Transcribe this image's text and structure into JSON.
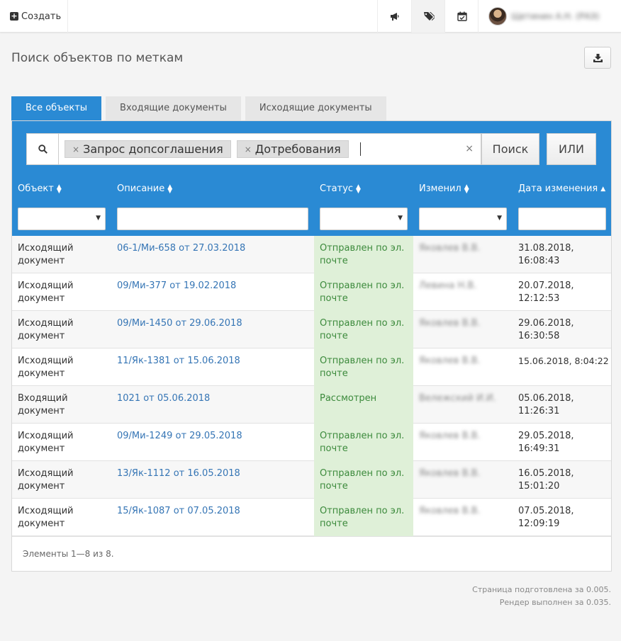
{
  "topbar": {
    "create_label": "Создать",
    "icons": [
      "megaphone-icon",
      "tags-icon",
      "calendar-check-icon"
    ],
    "user_name": "Щетинин А.Н. (РАЭ)"
  },
  "page": {
    "title": "Поиск объектов по меткам"
  },
  "tabs": [
    {
      "label": "Все объекты",
      "active": true
    },
    {
      "label": "Входящие документы",
      "active": false
    },
    {
      "label": "Исходящие документы",
      "active": false
    }
  ],
  "search": {
    "tags": [
      "Запрос допсоглашения",
      "Дотребования"
    ],
    "search_label": "Поиск",
    "or_label": "ИЛИ"
  },
  "columns": [
    {
      "label": "Объект",
      "sort": "both"
    },
    {
      "label": "Описание",
      "sort": "both"
    },
    {
      "label": "Статус",
      "sort": "both"
    },
    {
      "label": "Изменил",
      "sort": "both"
    },
    {
      "label": "Дата изменения",
      "sort": "asc"
    }
  ],
  "rows": [
    {
      "object": "Исходящий документ",
      "description": "06-1/Ми-658 от 27.03.2018",
      "status": "Отправлен по эл. почте",
      "changed_by": "Яковлев В.В.",
      "date": "31.08.2018, 16:08:43"
    },
    {
      "object": "Исходящий документ",
      "description": "09/Ми-377 от 19.02.2018",
      "status": "Отправлен по эл. почте",
      "changed_by": "Левина Н.В.",
      "date": "20.07.2018, 12:12:53"
    },
    {
      "object": "Исходящий документ",
      "description": "09/Ми-1450 от 29.06.2018",
      "status": "Отправлен по эл. почте",
      "changed_by": "Яковлев В.В.",
      "date": "29.06.2018, 16:30:58"
    },
    {
      "object": "Исходящий документ",
      "description": "11/Як-1381 от 15.06.2018",
      "status": "Отправлен по эл. почте",
      "changed_by": "Яковлев В.В.",
      "date": "15.06.2018, 8:04:22"
    },
    {
      "object": "Входящий документ",
      "description": "1021 от 05.06.2018",
      "status": "Рассмотрен",
      "changed_by": "Вележский И.И.",
      "date": "05.06.2018, 11:26:31"
    },
    {
      "object": "Исходящий документ",
      "description": "09/Ми-1249 от 29.05.2018",
      "status": "Отправлен по эл. почте",
      "changed_by": "Яковлев В.В.",
      "date": "29.05.2018, 16:49:31"
    },
    {
      "object": "Исходящий документ",
      "description": "13/Як-1112 от 16.05.2018",
      "status": "Отправлен по эл. почте",
      "changed_by": "Яковлев В.В.",
      "date": "16.05.2018, 15:01:20"
    },
    {
      "object": "Исходящий документ",
      "description": "15/Як-1087 от 07.05.2018",
      "status": "Отправлен по эл. почте",
      "changed_by": "Яковлев В.В.",
      "date": "07.05.2018, 12:09:19"
    }
  ],
  "footer": {
    "elements_info": "Элементы 1—8 из 8."
  },
  "render": {
    "page_prepared": "Страница подготовлена за 0.005.",
    "render_done": "Рендер выполнен за 0.035."
  },
  "colors": {
    "accent": "#2a8ad4",
    "status_bg": "#dff0d8",
    "status_text": "#3c8a3c",
    "link": "#3575b5"
  }
}
